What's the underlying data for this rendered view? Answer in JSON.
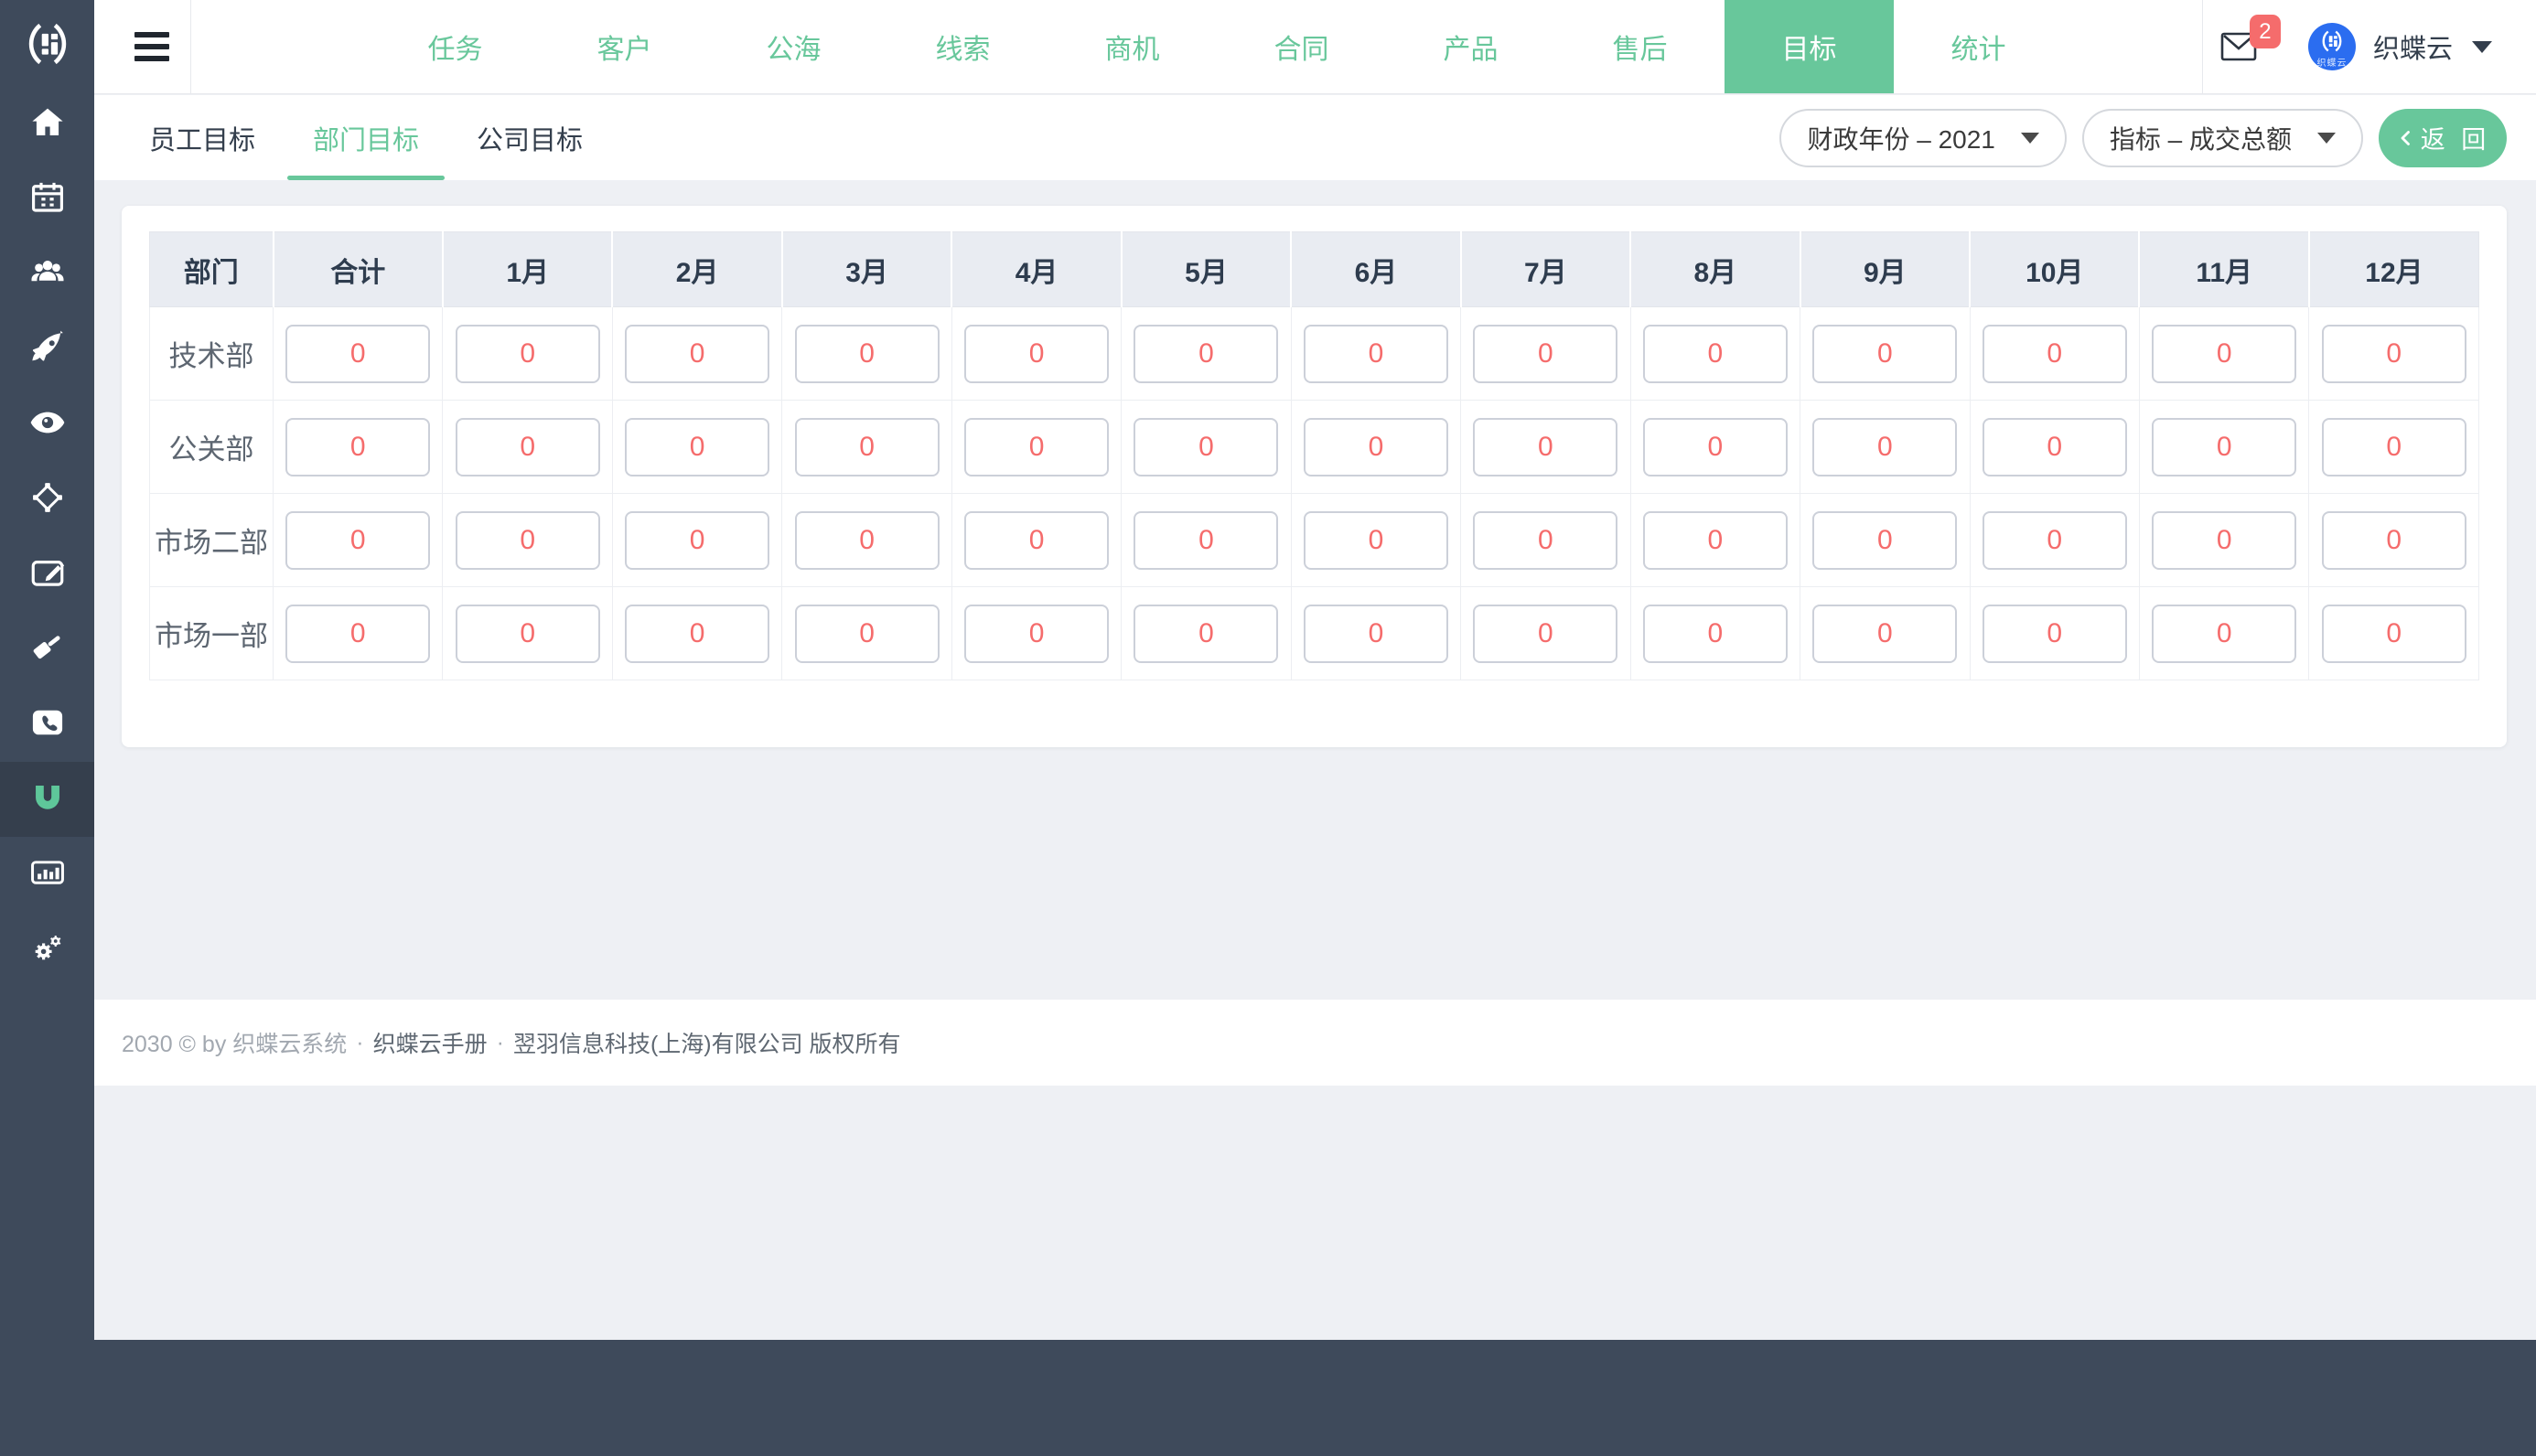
{
  "colors": {
    "accent": "#68c79b",
    "red": "#f56c6c",
    "avatar_blue": "#2b6df0",
    "sidebar": "#3e4a5b",
    "sidebar_active": "#353f4d",
    "page_bg": "#eef0f4",
    "table_header_bg": "#e9ecf2"
  },
  "sidebar": {
    "items": [
      {
        "name": "home",
        "icon": "home"
      },
      {
        "name": "calendar",
        "icon": "calendar"
      },
      {
        "name": "team",
        "icon": "team"
      },
      {
        "name": "rocket",
        "icon": "rocket"
      },
      {
        "name": "eye",
        "icon": "eye"
      },
      {
        "name": "nodes",
        "icon": "nodes"
      },
      {
        "name": "edit",
        "icon": "edit"
      },
      {
        "name": "hammer",
        "icon": "hammer"
      },
      {
        "name": "phone",
        "icon": "phone"
      },
      {
        "name": "magnet",
        "icon": "magnet",
        "active": true
      },
      {
        "name": "chart",
        "icon": "chart"
      },
      {
        "name": "settings",
        "icon": "settings"
      }
    ]
  },
  "topnav": {
    "items": [
      {
        "label": "任务",
        "name": "tasks"
      },
      {
        "label": "客户",
        "name": "customers"
      },
      {
        "label": "公海",
        "name": "open-sea"
      },
      {
        "label": "线索",
        "name": "leads"
      },
      {
        "label": "商机",
        "name": "opportunities"
      },
      {
        "label": "合同",
        "name": "contracts"
      },
      {
        "label": "产品",
        "name": "products"
      },
      {
        "label": "售后",
        "name": "after-sales"
      },
      {
        "label": "目标",
        "name": "goals",
        "active": true
      },
      {
        "label": "统计",
        "name": "statistics"
      }
    ]
  },
  "user": {
    "badge_count": "2",
    "name": "织蝶云",
    "avatar_label": "织蝶云"
  },
  "tabs": {
    "items": [
      {
        "label": "员工目标",
        "name": "employee-goals"
      },
      {
        "label": "部门目标",
        "name": "department-goals",
        "active": true
      },
      {
        "label": "公司目标",
        "name": "company-goals"
      }
    ]
  },
  "filters": {
    "fiscal_year": "财政年份 – 2021",
    "metric": "指标 – 成交总额",
    "back_label": "返 回"
  },
  "table": {
    "columns": [
      "部门",
      "合计",
      "1月",
      "2月",
      "3月",
      "4月",
      "5月",
      "6月",
      "7月",
      "8月",
      "9月",
      "10月",
      "11月",
      "12月"
    ],
    "rows": [
      {
        "department": "技术部",
        "values": [
          "0",
          "0",
          "0",
          "0",
          "0",
          "0",
          "0",
          "0",
          "0",
          "0",
          "0",
          "0",
          "0"
        ]
      },
      {
        "department": "公关部",
        "values": [
          "0",
          "0",
          "0",
          "0",
          "0",
          "0",
          "0",
          "0",
          "0",
          "0",
          "0",
          "0",
          "0"
        ]
      },
      {
        "department": "市场二部",
        "values": [
          "0",
          "0",
          "0",
          "0",
          "0",
          "0",
          "0",
          "0",
          "0",
          "0",
          "0",
          "0",
          "0"
        ]
      },
      {
        "department": "市场一部",
        "values": [
          "0",
          "0",
          "0",
          "0",
          "0",
          "0",
          "0",
          "0",
          "0",
          "0",
          "0",
          "0",
          "0"
        ]
      }
    ]
  },
  "footer": {
    "copyright": "2030 © by 织蝶云系统",
    "separator": "·",
    "manual": "织蝶云手册",
    "company": "翌羽信息科技(上海)有限公司 版权所有"
  }
}
